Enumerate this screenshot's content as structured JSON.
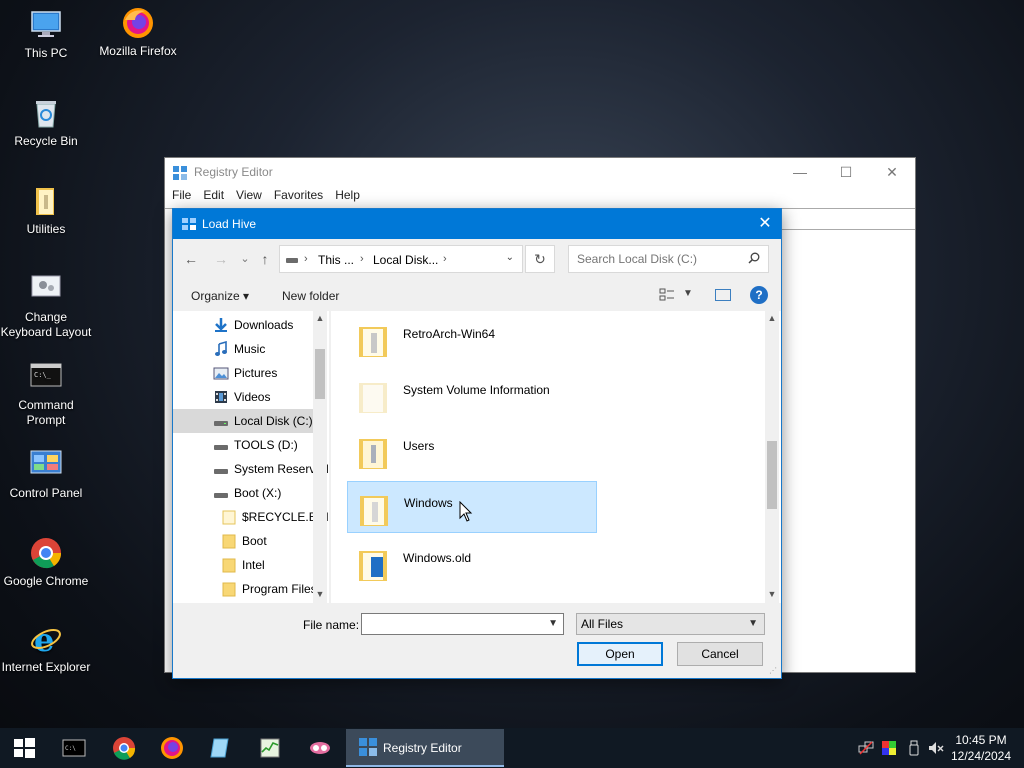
{
  "desktop": {
    "icons": [
      {
        "label": "This PC",
        "icon": "this-pc-icon"
      },
      {
        "label": "Mozilla Firefox",
        "icon": "firefox-icon"
      },
      {
        "label": "Recycle Bin",
        "icon": "recycle-bin-icon"
      },
      {
        "label": "Utilities",
        "icon": "folder-icon"
      },
      {
        "label": "Change Keyboard Layout",
        "icon": "keyboard-layout-icon"
      },
      {
        "label": "Command Prompt",
        "icon": "command-prompt-icon"
      },
      {
        "label": "Control Panel",
        "icon": "control-panel-icon"
      },
      {
        "label": "Google Chrome",
        "icon": "chrome-icon"
      },
      {
        "label": "Internet Explorer",
        "icon": "internet-explorer-icon"
      }
    ]
  },
  "regedit": {
    "title": "Registry Editor",
    "controls": {
      "minimize": "—",
      "maximize": "☐",
      "close": "✕"
    },
    "menu": [
      "File",
      "Edit",
      "View",
      "Favorites",
      "Help"
    ]
  },
  "dialog": {
    "title": "Load Hive",
    "close": "✕",
    "nav": {
      "back": "←",
      "forward": "→",
      "recent": "⌄",
      "up": "↑",
      "refresh": "↻"
    },
    "address": {
      "crumbs": [
        "This ...",
        "Local Disk..."
      ],
      "separator": "›"
    },
    "search": {
      "placeholder": "Search Local Disk (C:)"
    },
    "commands": {
      "organize": "Organize ▾",
      "new_folder": "New folder",
      "help": "?"
    },
    "nav_pane": [
      {
        "label": "Downloads",
        "icon": "downloads-icon"
      },
      {
        "label": "Music",
        "icon": "music-icon"
      },
      {
        "label": "Pictures",
        "icon": "pictures-icon"
      },
      {
        "label": "Videos",
        "icon": "videos-icon"
      },
      {
        "label": "Local Disk (C:)",
        "icon": "drive-icon",
        "selected": true
      },
      {
        "label": "TOOLS (D:)",
        "icon": "drive-icon"
      },
      {
        "label": "System Reserved",
        "icon": "drive-icon"
      },
      {
        "label": "Boot (X:)",
        "icon": "drive-icon"
      },
      {
        "label": "$RECYCLE.BIN",
        "icon": "folder-icon"
      },
      {
        "label": "Boot",
        "icon": "folder-icon"
      },
      {
        "label": "Intel",
        "icon": "folder-icon"
      },
      {
        "label": "Program Files",
        "icon": "folder-icon"
      }
    ],
    "files": [
      {
        "name": "RetroArch-Win64"
      },
      {
        "name": "System Volume Information"
      },
      {
        "name": "Users"
      },
      {
        "name": "Windows",
        "selected": true
      },
      {
        "name": "Windows.old"
      }
    ],
    "file_name": {
      "label": "File name:",
      "value": ""
    },
    "filter": {
      "value": "All Files"
    },
    "buttons": {
      "open": "Open",
      "cancel": "Cancel"
    }
  },
  "taskbar": {
    "active_app": "Registry Editor",
    "time": "10:45 PM",
    "date": "12/24/2024"
  },
  "colors": {
    "accent": "#0078d7",
    "selection": "#cce8ff",
    "taskbar": "#101923",
    "folder": "#f8d775"
  }
}
